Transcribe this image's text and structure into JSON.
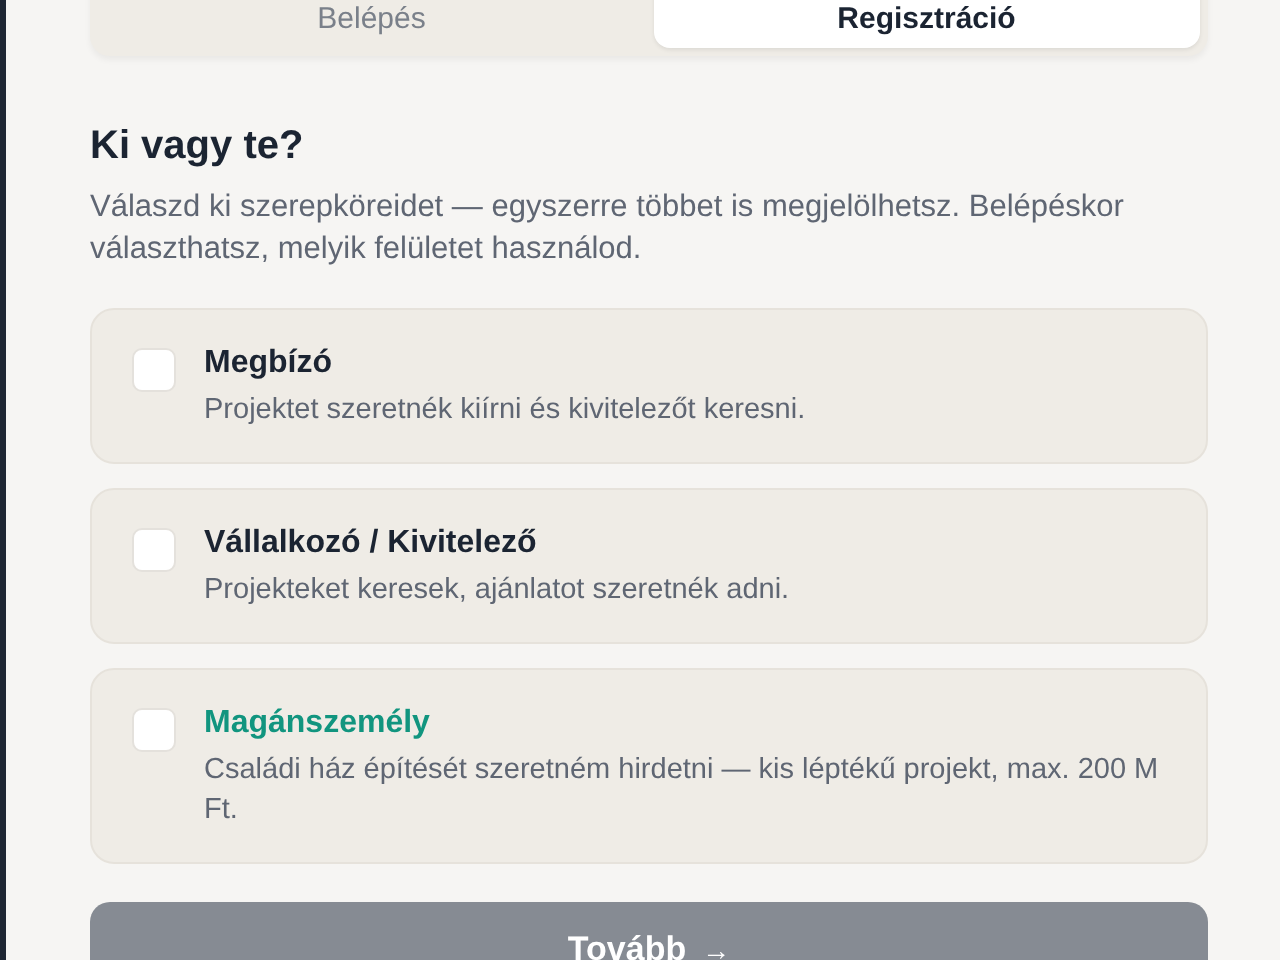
{
  "tabs": [
    {
      "label": "Belépés",
      "selected": false
    },
    {
      "label": "Regisztráció",
      "selected": true
    }
  ],
  "heading": "Ki vagy te?",
  "description": "Válaszd ki szerepköreidet — egyszerre többet is megjelölhetsz. Belépéskor választhatsz, melyik felületet használod.",
  "roles": [
    {
      "title": "Megbízó",
      "text": "Projektet szeretnék kiírni és kivitelezőt keresni.",
      "checked": false,
      "highlighted": false
    },
    {
      "title": "Vállalkozó / Kivitelező",
      "text": "Projekteket keresek, ajánlatot szeretnék adni.",
      "checked": false,
      "highlighted": false
    },
    {
      "title": "Magánszemély",
      "text": "Családi ház építését szeretném hirdetni — kis léptékű projekt, max. 200 M Ft.",
      "checked": false,
      "highlighted": true
    }
  ],
  "next_button": {
    "label": "Tovább",
    "icon": "→",
    "disabled": true
  }
}
